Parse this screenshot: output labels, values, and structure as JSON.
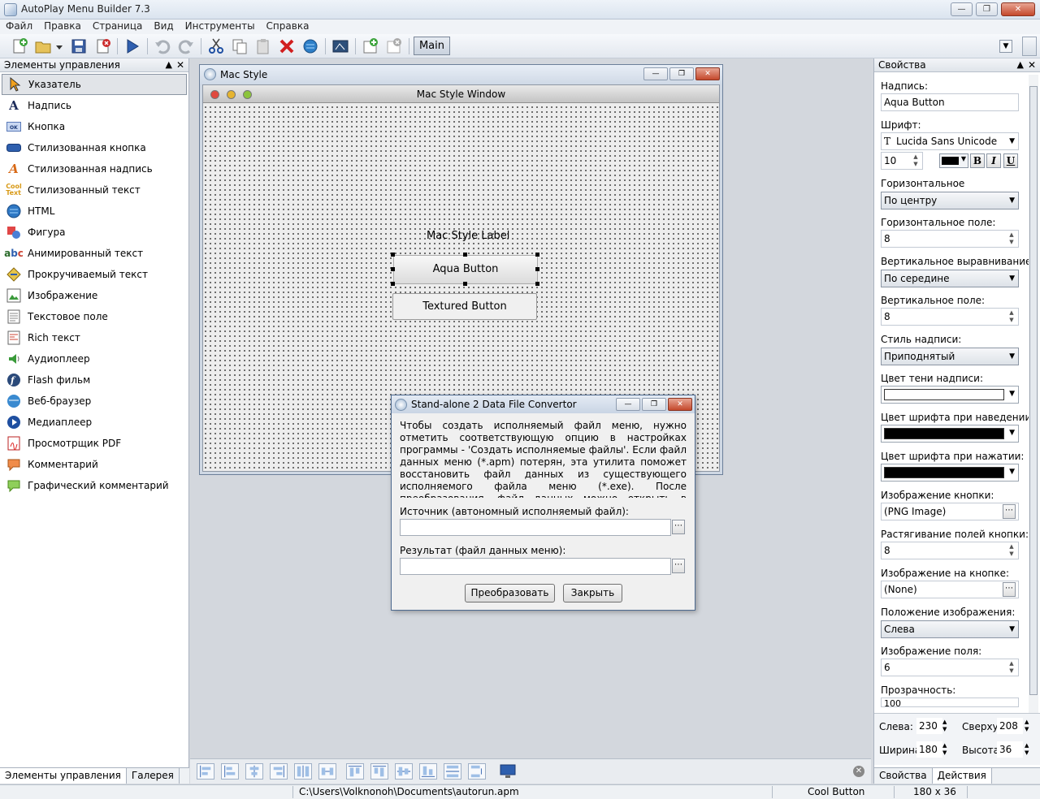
{
  "app": {
    "title": "AutoPlay Menu Builder 7.3"
  },
  "menu": [
    "Файл",
    "Правка",
    "Страница",
    "Вид",
    "Инструменты",
    "Справка"
  ],
  "toolbar": {
    "page_tab": "Main"
  },
  "left_panel": {
    "title": "Элементы управления",
    "items": [
      "Указатель",
      "Надпись",
      "Кнопка",
      "Стилизованная кнопка",
      "Стилизованная надпись",
      "Стилизованный текст",
      "HTML",
      "Фигура",
      "Анимированный текст",
      "Прокручиваемый текст",
      "Изображение",
      "Текстовое поле",
      "Rich текст",
      "Аудиоплеер",
      "Flash фильм",
      "Веб-браузер",
      "Медиаплеер",
      "Просмотрщик PDF",
      "Комментарий",
      "Графический комментарий"
    ],
    "tabs": [
      "Элементы управления",
      "Галерея"
    ]
  },
  "mac_window": {
    "title": "Mac Style",
    "inner_title": "Mac Style Window",
    "label": "Mac Style Label",
    "aqua_button": "Aqua Button",
    "textured_button": "Textured Button"
  },
  "dialog": {
    "title": "Stand-alone 2 Data File Convertor",
    "description": "Чтобы создать исполняемый файл меню, нужно отметить соответствующую опцию в настройках программы - 'Создать исполняемые файлы'. Если файл данных меню (*.apm) потерян, эта утилита поможет восстановить файл данных из существующего исполняемого файла меню (*.exe). После преобразования, файл данных можно открыть в AutoPlay Menu Builder.",
    "source_label": "Источник (автономный исполняемый файл):",
    "source_value": "",
    "result_label": "Результат (файл данных меню):",
    "result_value": "",
    "convert_button": "Преобразовать",
    "close_button": "Закрыть"
  },
  "properties": {
    "title": "Свойства",
    "caption_label": "Надпись:",
    "caption_value": "Aqua Button",
    "font_label": "Шрифт:",
    "font_value": "Lucida Sans Unicode",
    "font_size": "10",
    "bold": "B",
    "italic": "I",
    "underline": "U",
    "h_align_label": "Горизонтальное",
    "h_align_value": "По центру",
    "h_margin_label": "Горизонтальное поле:",
    "h_margin_value": "8",
    "v_align_label": "Вертикальное выравнивание:",
    "v_align_value": "По середине",
    "v_margin_label": "Вертикальное поле:",
    "v_margin_value": "8",
    "caption_style_label": "Стиль надписи:",
    "caption_style_value": "Приподнятый",
    "shadow_color_label": "Цвет тени надписи:",
    "hover_color_label": "Цвет шрифта при наведении:",
    "pressed_color_label": "Цвет шрифта при нажатии:",
    "button_image_label": "Изображение кнопки:",
    "button_image_value": "(PNG Image)",
    "stretch_label": "Растягивание полей кнопки:",
    "stretch_value": "8",
    "image_on_button_label": "Изображение на кнопке:",
    "image_on_button_value": "(None)",
    "image_position_label": "Положение изображения:",
    "image_position_value": "Слева",
    "image_margin_label": "Изображение поля:",
    "image_margin_value": "6",
    "transparency_label": "Прозрачность:",
    "transparency_value": "100",
    "colors": {
      "shadow": "#ffffff",
      "hover": "#000000",
      "pressed": "#000000",
      "font": "#000000"
    }
  },
  "geometry": {
    "left_label": "Слева:",
    "left_value": "230",
    "top_label": "Сверху:",
    "top_value": "208",
    "width_label": "Ширина",
    "width_value": "180",
    "height_label": "Высота:",
    "height_value": "36"
  },
  "right_tabs": [
    "Свойства",
    "Действия"
  ],
  "status": {
    "path": "C:\\Users\\Volknonoh\\Documents\\autorun.apm",
    "element": "Cool Button",
    "size": "180 x 36"
  }
}
